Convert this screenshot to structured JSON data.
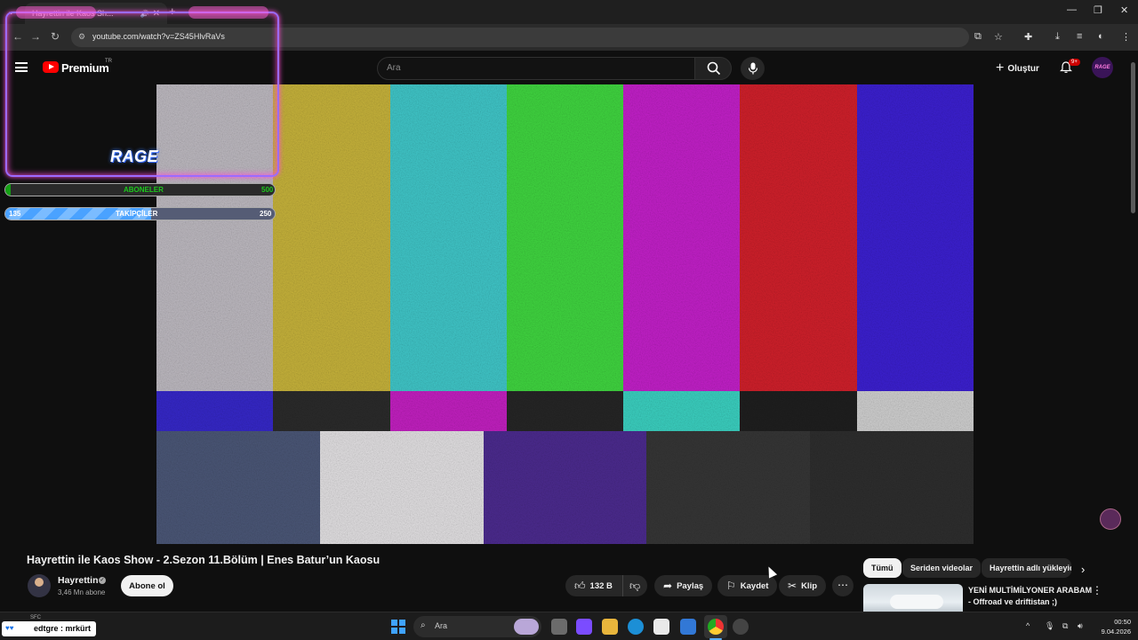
{
  "browser": {
    "tab_title": "Hayrettin ile Kaos Sh...",
    "url": "youtube.com/watch?v=ZS45HlvRaVs"
  },
  "header": {
    "brand": "Premium",
    "region": "TR",
    "search_placeholder": "Ara",
    "create_label": "Oluştur",
    "notif_badge": "9+",
    "avatar_text": "RAGE"
  },
  "overlay": {
    "logo_text": "RAGE",
    "subs_label": "ABONELER",
    "subs_goal": "500",
    "subs_fraction": 0.02,
    "followers_current": "135",
    "followers_label": "TAKİPÇİLER",
    "followers_goal": "250",
    "followers_fraction": 0.54
  },
  "video": {
    "title": "Hayrettin ile Kaos Show - 2.Sezon 11.Bölüm | Enes Batur’un Kaosu",
    "top_bar_colors": [
      "#bdb9c0",
      "#c6b23a",
      "#3fc6c8",
      "#3fd53f",
      "#c21fc8",
      "#d01f2a",
      "#3b1fd0"
    ],
    "bottom_colors": [
      "#3527c8",
      "#2a2a2a",
      "#c21fc0",
      "#252525",
      "#3ad0c0",
      "#1e1e1e",
      "#cfcfcf"
    ],
    "lower_colors": [
      "#4a5676",
      "#e2e0e2",
      "#4b2a8e",
      "#353535",
      "#2d2d2d"
    ]
  },
  "channel": {
    "name": "Hayrettin",
    "subscribers": "3,46 Mn abone",
    "subscribe_label": "Abone ol"
  },
  "actions": {
    "likes": "132 B",
    "share": "Paylaş",
    "save": "Kaydet",
    "clip": "Klip"
  },
  "chips": [
    "Tümü",
    "Seriden videolar",
    "Hayrettin adlı yükleyici"
  ],
  "recommendation": {
    "title_line1": "YENİ MULTİMİLYONER ARABAM",
    "title_line2": "- Offroad ve driftistan ;)"
  },
  "taskbar": {
    "search_placeholder": "Ara",
    "time": "00:50",
    "date": "9.04.2026",
    "user_label": "edtgre : mrkürt",
    "user_icons": "♥♥",
    "sfc": "SFC"
  }
}
